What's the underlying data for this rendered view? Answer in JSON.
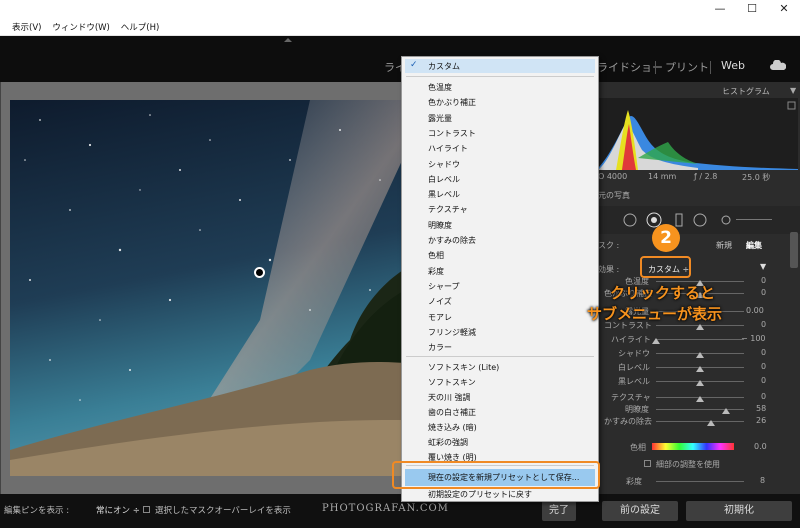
{
  "menubar": {
    "items": [
      "表示(V)",
      "ウィンドウ(W)",
      "ヘルプ(H)"
    ]
  },
  "window_controls": {
    "minimize": "—",
    "maximize": "☐",
    "close": "✕"
  },
  "modules": {
    "library_partial": "ライ",
    "slideshow_partial": "ライドショー",
    "print": "プリント",
    "web": "Web"
  },
  "histogram": {
    "title": "ヒストグラム",
    "iso": "O 4000",
    "focal": "14 mm",
    "aperture": "ƒ / 2.8",
    "shutter": "25.0 秒",
    "original_photo": "元の写真"
  },
  "mask_header": {
    "mask_partial": "スク :",
    "new": "新規",
    "edit": "編集"
  },
  "effect": {
    "label": "効果 :",
    "preset_value": "カスタム ÷"
  },
  "adjustments": [
    {
      "label": "色温度",
      "value": "0",
      "knob": 0.5
    },
    {
      "label": "色かぶり補正",
      "value": "0",
      "knob": 0.5
    },
    {
      "label": "露光量",
      "value": "0.00",
      "knob": 0.5
    },
    {
      "label": "コントラスト",
      "value": "0",
      "knob": 0.5
    },
    {
      "label": "ハイライト",
      "value": "− 100",
      "knob": 0.0
    },
    {
      "label": "シャドウ",
      "value": "0",
      "knob": 0.5
    },
    {
      "label": "白レベル",
      "value": "0",
      "knob": 0.5
    },
    {
      "label": "黒レベル",
      "value": "0",
      "knob": 0.5
    },
    {
      "label": "テクスチャ",
      "value": "0",
      "knob": 0.5
    },
    {
      "label": "明瞭度",
      "value": "58",
      "knob": 0.79
    },
    {
      "label": "かすみの除去",
      "value": "26",
      "knob": 0.63
    }
  ],
  "color": {
    "label": "色相",
    "value": "0.0",
    "fine_adjust": "細部の調整を使用",
    "saturation_label": "彩度",
    "saturation_value": "8"
  },
  "preset_menu": {
    "checked": "カスタム",
    "group1": [
      "色温度",
      "色かぶり補正",
      "露光量",
      "コントラスト",
      "ハイライト",
      "シャドウ",
      "白レベル",
      "黒レベル",
      "テクスチャ",
      "明瞭度",
      "かすみの除去",
      "色相",
      "彩度",
      "シャープ",
      "ノイズ",
      "モアレ",
      "フリンジ軽減",
      "カラー"
    ],
    "group2": [
      "ソフトスキン (Lite)",
      "ソフトスキン",
      "天の川 強調",
      "歯の白さ補正",
      "焼き込み (暗)",
      "虹彩の強調",
      "覆い焼き (明)"
    ],
    "save_item": "現在の設定を新規プリセットとして保存...",
    "restore_item": "初期設定のプリセットに戻す"
  },
  "annotation": {
    "step": "2",
    "line1": "クリックすると",
    "line2": "サブメニューが表示"
  },
  "bottom": {
    "pin_label": "編集ピンを表示 :",
    "pin_value": "常にオン ÷",
    "overlay_label": "選択したマスクオーバーレイを表示",
    "watermark": "PHOTOGRAFAN.COM",
    "done": "完了",
    "previous": "前の設定",
    "reset": "初期化"
  }
}
